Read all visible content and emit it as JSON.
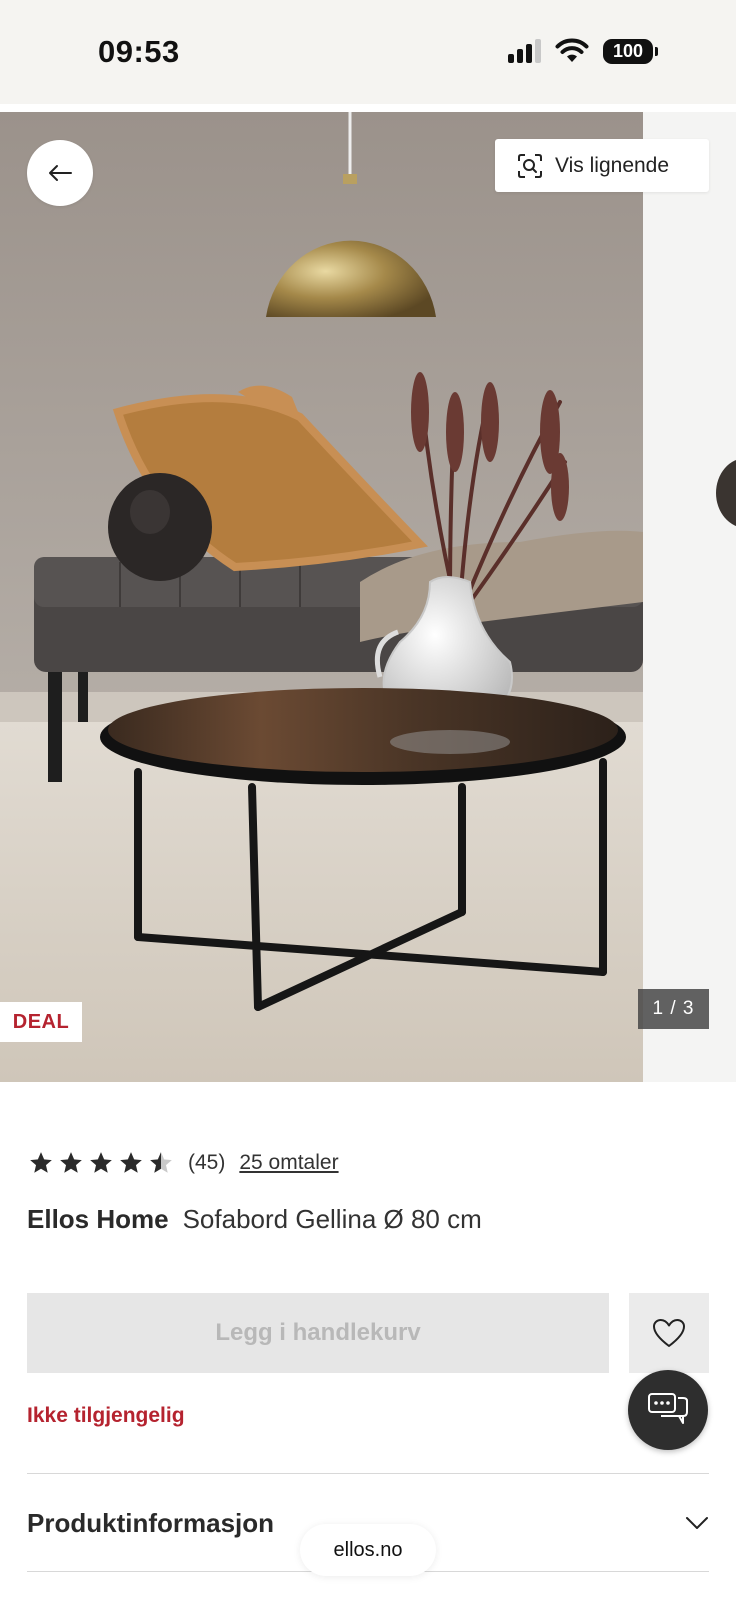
{
  "status_bar": {
    "time": "09:53",
    "battery": "100",
    "icons": [
      "signal-icon",
      "wifi-icon",
      "battery-icon"
    ]
  },
  "gallery": {
    "similar_label": "Vis lignende",
    "deal_badge": "DEAL",
    "counter": "1 / 3",
    "icons": [
      "back-arrow-icon",
      "visual-search-icon"
    ]
  },
  "product": {
    "rating_value": 4.5,
    "rating_max": 5,
    "rating_count": "(45)",
    "reviews_link": "25 omtaler",
    "brand": "Ellos Home",
    "name": "Sofabord Gellina Ø 80 cm",
    "add_to_cart_label": "Legg i handlekurv",
    "availability": "Ikke tilgjengelig"
  },
  "sections": {
    "product_info": "Produktinformasjon"
  },
  "browser": {
    "url": "ellos.no"
  },
  "colors": {
    "accent_red": "#b5232f",
    "disabled_button": "#e6e6e6",
    "chat_button": "#2e2e2e"
  }
}
